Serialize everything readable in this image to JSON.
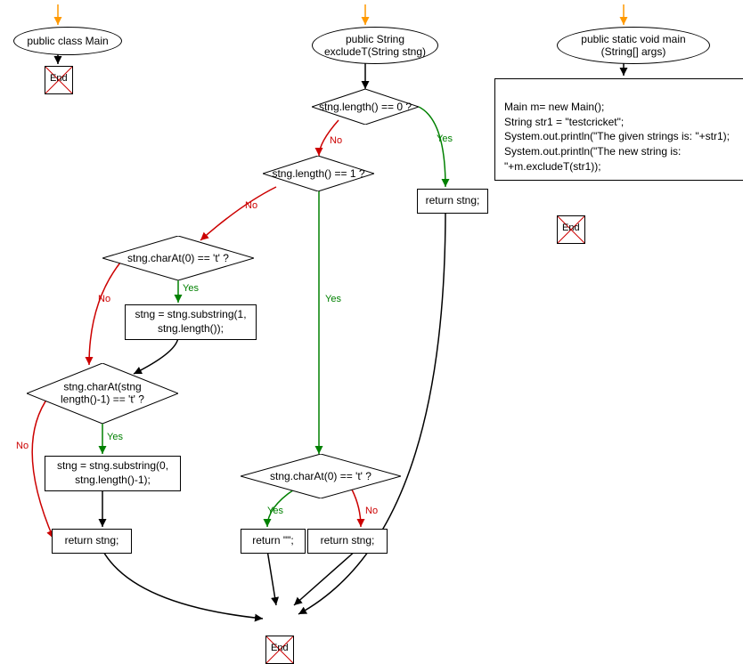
{
  "column1": {
    "start": "public class Main",
    "end": "End"
  },
  "column2": {
    "start": "public String\nexcludeT(String stng)",
    "d1": "stng.length() == 0 ?",
    "d2": "stng.length() == 1 ?",
    "d3": "stng.charAt(0) == 't' ?",
    "r1": "stng = stng.substring(1,\nstng.length());",
    "d4": "stng.charAt(stng\nlength()-1) == 't' ?",
    "r2": "stng = stng.substring(0,\nstng.length()-1);",
    "r3": "return stng;",
    "r4": "return stng;",
    "d5": "stng.charAt(0) == 't' ?",
    "r5": "return \"\";",
    "r6": "return stng;",
    "end": "End"
  },
  "column3": {
    "start": "public static void main\n(String[] args)",
    "code": "Main m= new Main();\nString str1 = \"testcricket\";\nSystem.out.println(\"The given strings is: \"+str1);\nSystem.out.println(\"The new string is: \"+m.excludeT(str1));",
    "end": "End"
  },
  "labels": {
    "yes": "Yes",
    "no": "No"
  }
}
